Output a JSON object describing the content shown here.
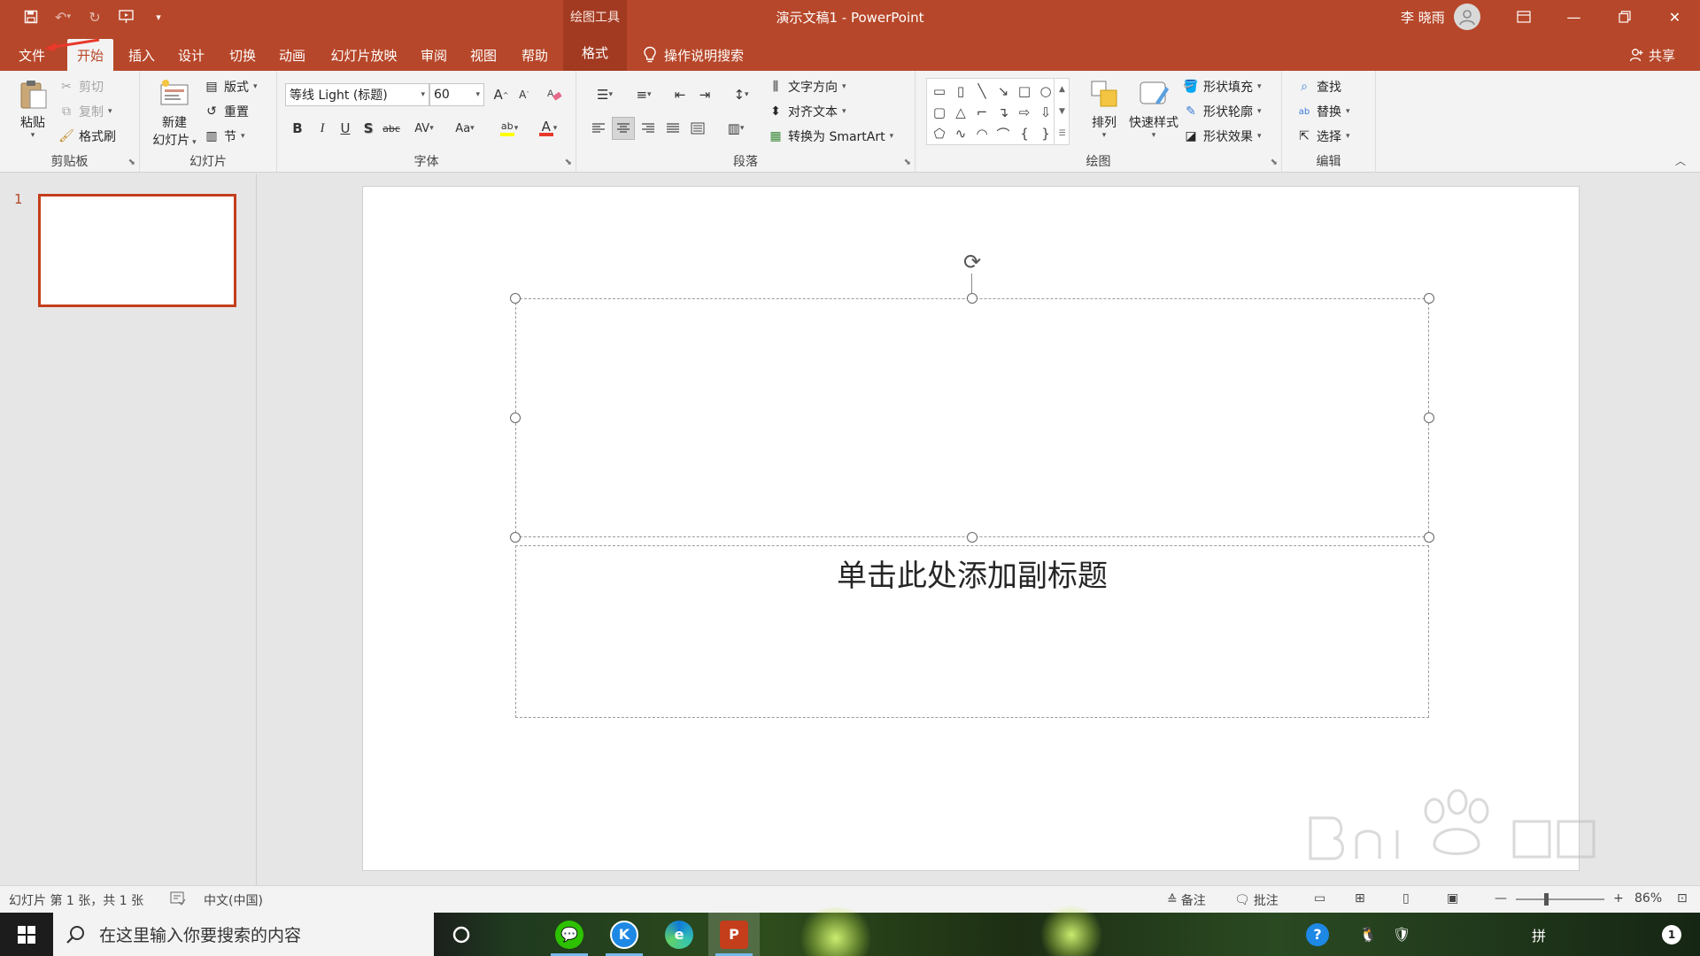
{
  "window": {
    "title": "演示文稿1  -  PowerPoint",
    "context_tab_group": "绘图工具",
    "user_name": "李 晓雨",
    "share_label": "共享"
  },
  "tabs": [
    {
      "label": "文件"
    },
    {
      "label": "开始"
    },
    {
      "label": "插入"
    },
    {
      "label": "设计"
    },
    {
      "label": "切换"
    },
    {
      "label": "动画"
    },
    {
      "label": "幻灯片放映"
    },
    {
      "label": "审阅"
    },
    {
      "label": "视图"
    },
    {
      "label": "帮助"
    },
    {
      "label": "格式"
    }
  ],
  "active_tab": "开始",
  "tell_me": "操作说明搜索",
  "ribbon": {
    "clipboard": {
      "label": "剪贴板",
      "paste": "粘贴",
      "cut": "剪切",
      "copy": "复制",
      "format_painter": "格式刷"
    },
    "slides": {
      "label": "幻灯片",
      "new_slide_line1": "新建",
      "new_slide_line2": "幻灯片",
      "layout": "版式",
      "reset": "重置",
      "section": "节"
    },
    "font": {
      "label": "字体",
      "font_name": "等线 Light (标题)",
      "font_size": "60",
      "bold": "B",
      "italic": "I",
      "underline": "U",
      "shadow": "S",
      "strike": "abc",
      "spacing": "AV",
      "case": "Aa",
      "grow": "A",
      "shrink": "A",
      "color_letter": "A",
      "highlight": "ab"
    },
    "paragraph": {
      "label": "段落",
      "text_direction": "文字方向",
      "align_text": "对齐文本",
      "smartart": "转换为 SmartArt"
    },
    "drawing": {
      "label": "绘图",
      "arrange": "排列",
      "quick_styles": "快速样式",
      "shape_fill": "形状填充",
      "shape_outline": "形状轮廓",
      "shape_effects": "形状效果"
    },
    "editing": {
      "label": "编辑",
      "find": "查找",
      "replace": "替换",
      "select": "选择"
    }
  },
  "thumbnails": [
    {
      "number": "1"
    }
  ],
  "slide": {
    "subtitle_placeholder": "单击此处添加副标题"
  },
  "statusbar": {
    "slide_info": "幻灯片 第 1 张，共 1 张",
    "language": "中文(中国)",
    "notes": "备注",
    "comments": "批注",
    "zoom": "86%"
  },
  "taskbar": {
    "search_placeholder": "在这里输入你要搜索的内容",
    "apps": [
      {
        "name": "cortana-icon"
      },
      {
        "name": "wechat-icon"
      },
      {
        "name": "k-app-icon"
      },
      {
        "name": "edge-icon"
      },
      {
        "name": "powerpoint-icon"
      }
    ],
    "ime": "拼"
  },
  "colors": {
    "accent": "#b7472a",
    "context_tab": "#a23a22",
    "thumb_border": "#c43e1c"
  }
}
